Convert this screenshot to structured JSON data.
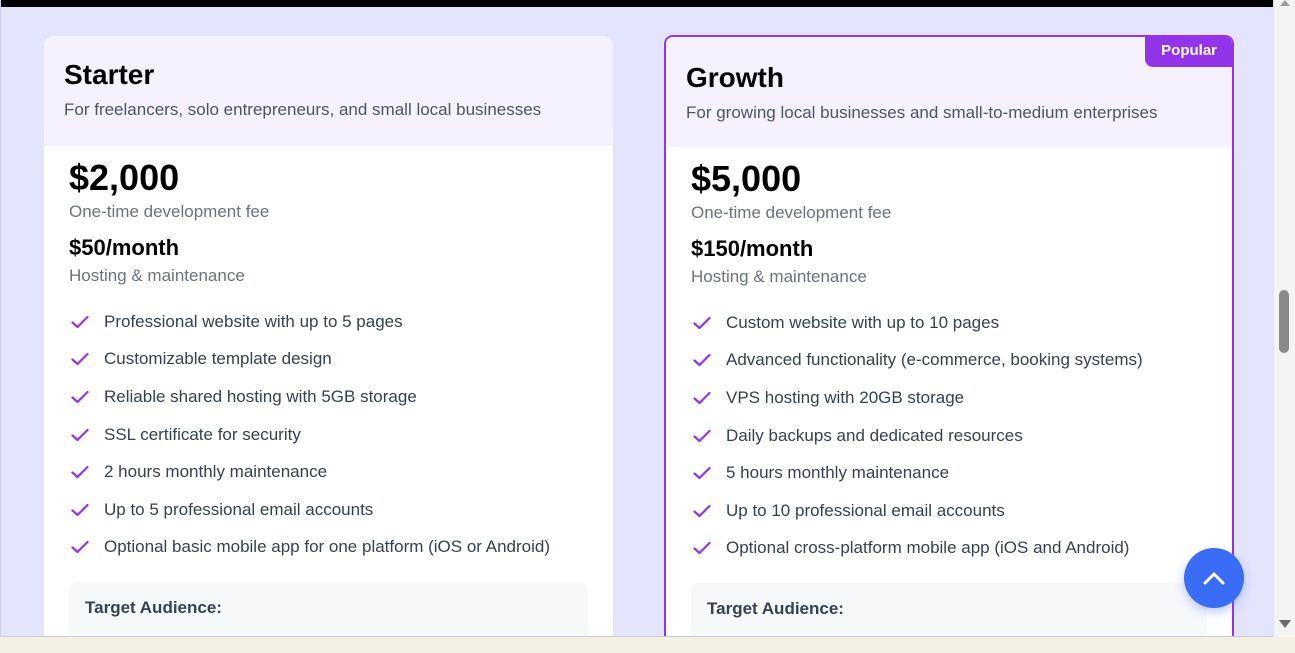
{
  "colors": {
    "accent": "#9333ea",
    "page_background": "#e4e4fd",
    "card_header_background": "#f6f1fe",
    "scroll_button": "#3b6cf6"
  },
  "plans": [
    {
      "title": "Starter",
      "description": "For freelancers, solo entrepreneurs, and small local businesses",
      "badge": "",
      "price": "$2,000",
      "price_note": "One-time development fee",
      "monthly": "$50/month",
      "monthly_note": "Hosting & maintenance",
      "features": [
        "Professional website with up to 5 pages",
        "Customizable template design",
        "Reliable shared hosting with 5GB storage",
        "SSL certificate for security",
        "2 hours monthly maintenance",
        "Up to 5 professional email accounts",
        "Optional basic mobile app for one platform (iOS or Android)"
      ],
      "audience_title": "Target Audience:"
    },
    {
      "title": "Growth",
      "description": "For growing local businesses and small-to-medium enterprises",
      "badge": "Popular",
      "price": "$5,000",
      "price_note": "One-time development fee",
      "monthly": "$150/month",
      "monthly_note": "Hosting & maintenance",
      "features": [
        "Custom website with up to 10 pages",
        "Advanced functionality (e-commerce, booking systems)",
        "VPS hosting with 20GB storage",
        "Daily backups and dedicated resources",
        "5 hours monthly maintenance",
        "Up to 10 professional email accounts",
        "Optional cross-platform mobile app (iOS and Android)"
      ],
      "audience_title": "Target Audience:"
    }
  ],
  "icons": {
    "feature": "check-icon",
    "scroll_top": "chevron-up-icon"
  }
}
